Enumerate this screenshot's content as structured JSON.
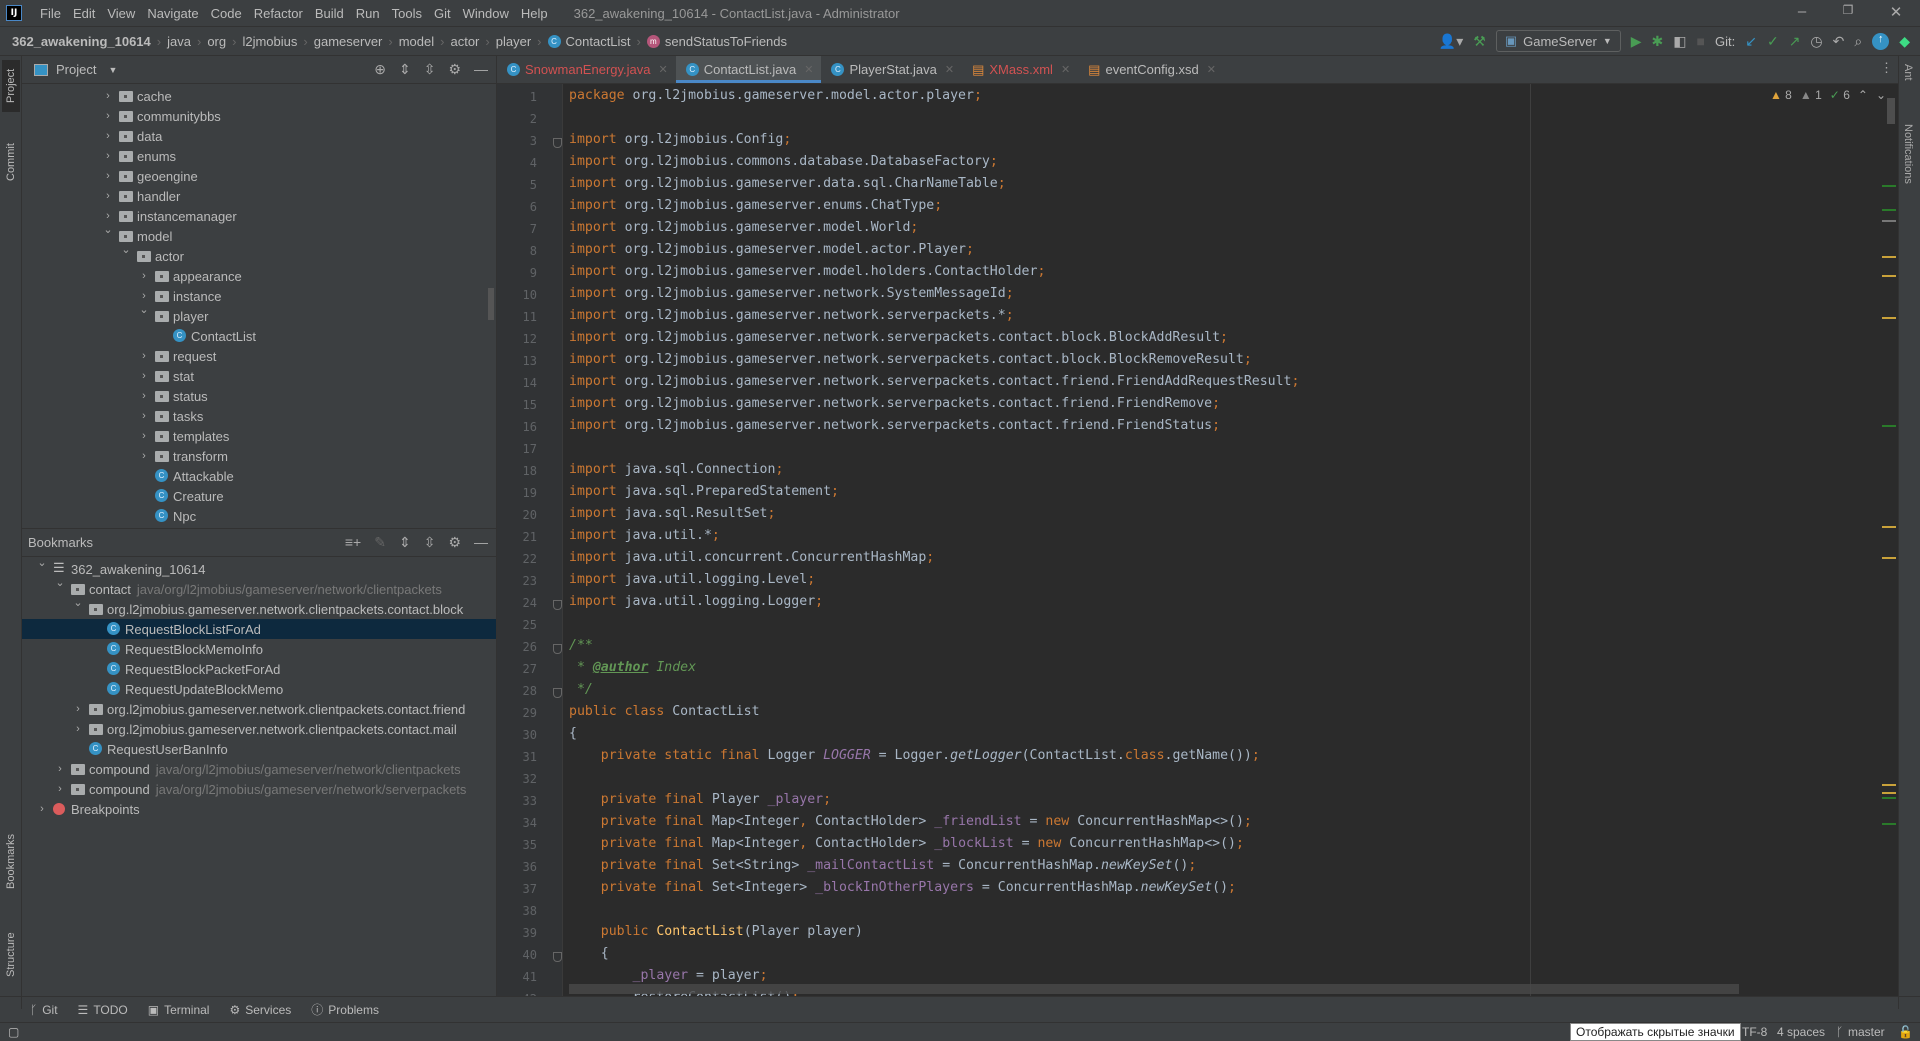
{
  "menu": {
    "items": [
      "File",
      "Edit",
      "View",
      "Navigate",
      "Code",
      "Refactor",
      "Build",
      "Run",
      "Tools",
      "Git",
      "Window",
      "Help"
    ],
    "window_title": "362_awakening_10614 - ContactList.java - Administrator"
  },
  "breadcrumb": [
    "362_awakening_10614",
    "java",
    "org",
    "l2jmobius",
    "gameserver",
    "model",
    "actor",
    "player"
  ],
  "breadcrumb_class": "ContactList",
  "breadcrumb_method": "sendStatusToFriends",
  "toolbar": {
    "run_config": "GameServer",
    "git_label": "Git:"
  },
  "project": {
    "title": "Project",
    "rows": [
      {
        "d": 0,
        "t": "folder",
        "o": false,
        "l": "cache"
      },
      {
        "d": 0,
        "t": "folder",
        "o": false,
        "l": "communitybbs"
      },
      {
        "d": 0,
        "t": "folder",
        "o": false,
        "l": "data"
      },
      {
        "d": 0,
        "t": "folder",
        "o": false,
        "l": "enums"
      },
      {
        "d": 0,
        "t": "folder",
        "o": false,
        "l": "geoengine"
      },
      {
        "d": 0,
        "t": "folder",
        "o": false,
        "l": "handler"
      },
      {
        "d": 0,
        "t": "folder",
        "o": false,
        "l": "instancemanager"
      },
      {
        "d": 0,
        "t": "folder",
        "o": true,
        "l": "model"
      },
      {
        "d": 1,
        "t": "folder",
        "o": true,
        "l": "actor"
      },
      {
        "d": 2,
        "t": "folder",
        "o": false,
        "l": "appearance"
      },
      {
        "d": 2,
        "t": "folder",
        "o": false,
        "l": "instance"
      },
      {
        "d": 2,
        "t": "folder",
        "o": true,
        "l": "player"
      },
      {
        "d": 3,
        "t": "class",
        "l": "ContactList"
      },
      {
        "d": 2,
        "t": "folder",
        "o": false,
        "l": "request"
      },
      {
        "d": 2,
        "t": "folder",
        "o": false,
        "l": "stat"
      },
      {
        "d": 2,
        "t": "folder",
        "o": false,
        "l": "status"
      },
      {
        "d": 2,
        "t": "folder",
        "o": false,
        "l": "tasks"
      },
      {
        "d": 2,
        "t": "folder",
        "o": false,
        "l": "templates"
      },
      {
        "d": 2,
        "t": "folder",
        "o": false,
        "l": "transform"
      },
      {
        "d": 2,
        "t": "class",
        "l": "Attackable"
      },
      {
        "d": 2,
        "t": "class",
        "l": "Creature"
      },
      {
        "d": 2,
        "t": "class",
        "l": "Npc"
      }
    ]
  },
  "bookmarks": {
    "title": "Bookmarks",
    "rows": [
      {
        "d": 0,
        "t": "list",
        "o": true,
        "l": "362_awakening_10614"
      },
      {
        "d": 1,
        "t": "folder",
        "o": true,
        "l": "contact",
        "p": "java/org/l2jmobius/gameserver/network/clientpackets"
      },
      {
        "d": 2,
        "t": "folder",
        "o": true,
        "l": "org.l2jmobius.gameserver.network.clientpackets.contact.block"
      },
      {
        "d": 3,
        "t": "class",
        "l": "RequestBlockListForAd",
        "sel": true
      },
      {
        "d": 3,
        "t": "class",
        "l": "RequestBlockMemoInfo"
      },
      {
        "d": 3,
        "t": "class",
        "l": "RequestBlockPacketForAd"
      },
      {
        "d": 3,
        "t": "class",
        "l": "RequestUpdateBlockMemo"
      },
      {
        "d": 2,
        "t": "folder",
        "o": false,
        "l": "org.l2jmobius.gameserver.network.clientpackets.contact.friend"
      },
      {
        "d": 2,
        "t": "folder",
        "o": false,
        "l": "org.l2jmobius.gameserver.network.clientpackets.contact.mail"
      },
      {
        "d": 2,
        "t": "class",
        "l": "RequestUserBanInfo"
      },
      {
        "d": 1,
        "t": "folder",
        "o": false,
        "l": "compound",
        "p": "java/org/l2jmobius/gameserver/network/clientpackets"
      },
      {
        "d": 1,
        "t": "folder",
        "o": false,
        "l": "compound",
        "p": "java/org/l2jmobius/gameserver/network/serverpackets"
      },
      {
        "d": 0,
        "t": "bp",
        "o": false,
        "l": "Breakpoints"
      }
    ]
  },
  "tabs": [
    {
      "label": "SnowmanEnergy.java",
      "icon": "class",
      "error": true
    },
    {
      "label": "ContactList.java",
      "icon": "class",
      "active": true
    },
    {
      "label": "PlayerStat.java",
      "icon": "class"
    },
    {
      "label": "XMass.xml",
      "icon": "xml",
      "error": true
    },
    {
      "label": "eventConfig.xsd",
      "icon": "xsd"
    }
  ],
  "inspections": {
    "warnings": "8",
    "weak_warnings": "1",
    "typos": "6"
  },
  "colors": {
    "keyword": "#cc7832",
    "text": "#a9b7c6",
    "field": "#9876aa",
    "doc": "#629755",
    "method_decl": "#ffc66d",
    "accent": "#4a88c7",
    "selection": "#0d293e"
  },
  "code": [
    [
      [
        "k",
        "package "
      ],
      [
        "p",
        "org.l2jmobius.gameserver.model.actor.player"
      ],
      [
        "k",
        ";"
      ]
    ],
    [],
    [
      [
        "k",
        "import "
      ],
      [
        "p",
        "org.l2jmobius.Config"
      ],
      [
        "k",
        ";"
      ]
    ],
    [
      [
        "k",
        "import "
      ],
      [
        "p",
        "org.l2jmobius.commons.database.DatabaseFactory"
      ],
      [
        "k",
        ";"
      ]
    ],
    [
      [
        "k",
        "import "
      ],
      [
        "p",
        "org.l2jmobius.gameserver.data.sql.CharNameTable"
      ],
      [
        "k",
        ";"
      ]
    ],
    [
      [
        "k",
        "import "
      ],
      [
        "p",
        "org.l2jmobius.gameserver.enums.ChatType"
      ],
      [
        "k",
        ";"
      ]
    ],
    [
      [
        "k",
        "import "
      ],
      [
        "p",
        "org.l2jmobius.gameserver.model.World"
      ],
      [
        "k",
        ";"
      ]
    ],
    [
      [
        "k",
        "import "
      ],
      [
        "p",
        "org.l2jmobius.gameserver.model.actor.Player"
      ],
      [
        "k",
        ";"
      ]
    ],
    [
      [
        "k",
        "import "
      ],
      [
        "p",
        "org.l2jmobius.gameserver.model.holders.ContactHolder"
      ],
      [
        "k",
        ";"
      ]
    ],
    [
      [
        "k",
        "import "
      ],
      [
        "p",
        "org.l2jmobius.gameserver.network.SystemMessageId"
      ],
      [
        "k",
        ";"
      ]
    ],
    [
      [
        "k",
        "import "
      ],
      [
        "p",
        "org.l2jmobius.gameserver.network.serverpackets.*"
      ],
      [
        "k",
        ";"
      ]
    ],
    [
      [
        "k",
        "import "
      ],
      [
        "p",
        "org.l2jmobius.gameserver.network.serverpackets.contact.block.BlockAddResult"
      ],
      [
        "k",
        ";"
      ]
    ],
    [
      [
        "k",
        "import "
      ],
      [
        "p",
        "org.l2jmobius.gameserver.network.serverpackets.contact.block.BlockRemoveResult"
      ],
      [
        "k",
        ";"
      ]
    ],
    [
      [
        "k",
        "import "
      ],
      [
        "p",
        "org.l2jmobius.gameserver.network.serverpackets.contact.friend.FriendAddRequestResult"
      ],
      [
        "k",
        ";"
      ]
    ],
    [
      [
        "k",
        "import "
      ],
      [
        "p",
        "org.l2jmobius.gameserver.network.serverpackets.contact.friend.FriendRemove"
      ],
      [
        "k",
        ";"
      ]
    ],
    [
      [
        "k",
        "import "
      ],
      [
        "p",
        "org.l2jmobius.gameserver.network.serverpackets.contact.friend.FriendStatus"
      ],
      [
        "k",
        ";"
      ]
    ],
    [],
    [
      [
        "k",
        "import "
      ],
      [
        "p",
        "java.sql.Connection"
      ],
      [
        "k",
        ";"
      ]
    ],
    [
      [
        "k",
        "import "
      ],
      [
        "p",
        "java.sql.PreparedStatement"
      ],
      [
        "k",
        ";"
      ]
    ],
    [
      [
        "k",
        "import "
      ],
      [
        "p",
        "java.sql.ResultSet"
      ],
      [
        "k",
        ";"
      ]
    ],
    [
      [
        "k",
        "import "
      ],
      [
        "p",
        "java.util.*"
      ],
      [
        "k",
        ";"
      ]
    ],
    [
      [
        "k",
        "import "
      ],
      [
        "p",
        "java.util.concurrent.ConcurrentHashMap"
      ],
      [
        "k",
        ";"
      ]
    ],
    [
      [
        "k",
        "import "
      ],
      [
        "p",
        "java.util.logging.Level"
      ],
      [
        "k",
        ";"
      ]
    ],
    [
      [
        "k",
        "import "
      ],
      [
        "p",
        "java.util.logging.Logger"
      ],
      [
        "k",
        ";"
      ]
    ],
    [],
    [
      [
        "c",
        "/**"
      ]
    ],
    [
      [
        "c",
        " * "
      ],
      [
        "t",
        "@author"
      ],
      [
        "c",
        " Index"
      ]
    ],
    [
      [
        "c",
        " */"
      ]
    ],
    [
      [
        "k",
        "public class "
      ],
      [
        "p",
        "ContactList"
      ]
    ],
    [
      [
        "p",
        "{"
      ]
    ],
    [
      [
        "p",
        "    "
      ],
      [
        "k",
        "private static final "
      ],
      [
        "p",
        "Logger "
      ],
      [
        "sf",
        "LOGGER"
      ],
      [
        "p",
        " = Logger."
      ],
      [
        "m",
        "getLogger"
      ],
      [
        "p",
        "(ContactList."
      ],
      [
        "k",
        "class"
      ],
      [
        "p",
        ".getName())"
      ],
      [
        "k",
        ";"
      ]
    ],
    [],
    [
      [
        "p",
        "    "
      ],
      [
        "k",
        "private final "
      ],
      [
        "p",
        "Player "
      ],
      [
        "f",
        "_player"
      ],
      [
        "k",
        ";"
      ]
    ],
    [
      [
        "p",
        "    "
      ],
      [
        "k",
        "private final "
      ],
      [
        "p",
        "Map<Integer"
      ],
      [
        "k",
        ", "
      ],
      [
        "p",
        "ContactHolder> "
      ],
      [
        "f",
        "_friendList"
      ],
      [
        "p",
        " = "
      ],
      [
        "k",
        "new "
      ],
      [
        "p",
        "ConcurrentHashMap<>()"
      ],
      [
        "k",
        ";"
      ]
    ],
    [
      [
        "p",
        "    "
      ],
      [
        "k",
        "private final "
      ],
      [
        "p",
        "Map<Integer"
      ],
      [
        "k",
        ", "
      ],
      [
        "p",
        "ContactHolder> "
      ],
      [
        "f",
        "_blockList"
      ],
      [
        "p",
        " = "
      ],
      [
        "k",
        "new "
      ],
      [
        "p",
        "ConcurrentHashMap<>()"
      ],
      [
        "k",
        ";"
      ]
    ],
    [
      [
        "p",
        "    "
      ],
      [
        "k",
        "private final "
      ],
      [
        "p",
        "Set<String> "
      ],
      [
        "f",
        "_mailContactList"
      ],
      [
        "p",
        " = ConcurrentHashMap."
      ],
      [
        "m",
        "newKeySet"
      ],
      [
        "p",
        "()"
      ],
      [
        "k",
        ";"
      ]
    ],
    [
      [
        "p",
        "    "
      ],
      [
        "k",
        "private final "
      ],
      [
        "p",
        "Set<Integer> "
      ],
      [
        "f",
        "_blockInOtherPlayers"
      ],
      [
        "p",
        " = ConcurrentHashMap."
      ],
      [
        "m",
        "newKeySet"
      ],
      [
        "p",
        "()"
      ],
      [
        "k",
        ";"
      ]
    ],
    [],
    [
      [
        "p",
        "    "
      ],
      [
        "k",
        "public "
      ],
      [
        "fn",
        "ContactList"
      ],
      [
        "p",
        "(Player player)"
      ]
    ],
    [
      [
        "p",
        "    {"
      ]
    ],
    [
      [
        "p",
        "        "
      ],
      [
        "f",
        "_player"
      ],
      [
        "p",
        " = player"
      ],
      [
        "k",
        ";"
      ]
    ],
    [
      [
        "p",
        "        restoreContactList()"
      ],
      [
        "k",
        ";"
      ]
    ]
  ],
  "bottom_tools": [
    "Git",
    "TODO",
    "Terminal",
    "Services",
    "Problems"
  ],
  "left_tools": {
    "project": "Project",
    "commit": "Commit",
    "bookmarks": "Bookmarks",
    "structure": "Structure"
  },
  "right_tools": {
    "ant": "Ant",
    "notifications": "Notifications"
  },
  "status": {
    "tooltip": "Отображать скрытые значки",
    "encoding": "TF-8",
    "indent": "4 spaces",
    "branch": "master"
  }
}
